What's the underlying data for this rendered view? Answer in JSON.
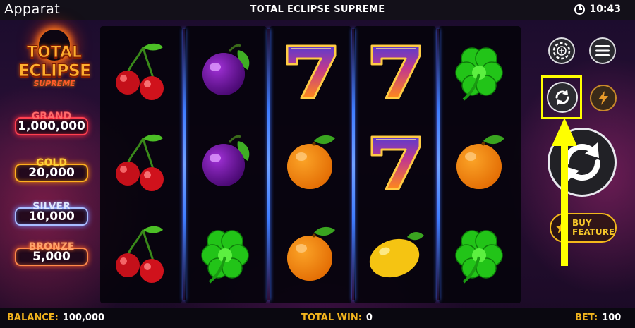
{
  "app": {
    "brand": "Apparat",
    "title": "TOTAL ECLIPSE SUPREME",
    "time": "10:43"
  },
  "logo": {
    "line1": "TOTAL",
    "line2": "ECLIPSE",
    "line3": "SUPREME"
  },
  "jackpots": [
    {
      "label": "GRAND",
      "value": "1,000,000"
    },
    {
      "label": "GOLD",
      "value": "20,000"
    },
    {
      "label": "SILVER",
      "value": "10,000"
    },
    {
      "label": "BRONZE",
      "value": "5,000"
    }
  ],
  "reels": [
    [
      "cherry",
      "cherry",
      "cherry"
    ],
    [
      "plum",
      "plum",
      "clover"
    ],
    [
      "seven",
      "orange",
      "orange"
    ],
    [
      "seven",
      "seven",
      "lemon"
    ],
    [
      "clover",
      "orange",
      "clover"
    ]
  ],
  "controls": {
    "chip_icon": "chip-icon",
    "menu_icon": "hamburger-icon",
    "autoplay_icon": "autoplay-icon",
    "turbo_icon": "lightning-icon",
    "spin_icon": "spin-icon",
    "buy_feature_line1": "BUY",
    "buy_feature_line2": "FEATURE"
  },
  "footer": {
    "balance_label": "BALANCE:",
    "balance_value": "100,000",
    "total_win_label": "TOTAL WIN:",
    "total_win_value": "0",
    "bet_label": "BET:",
    "bet_value": "100"
  },
  "colors": {
    "accent": "#f2b41e",
    "highlight": "#ffff00",
    "reel_separator": "#3f7dff"
  }
}
